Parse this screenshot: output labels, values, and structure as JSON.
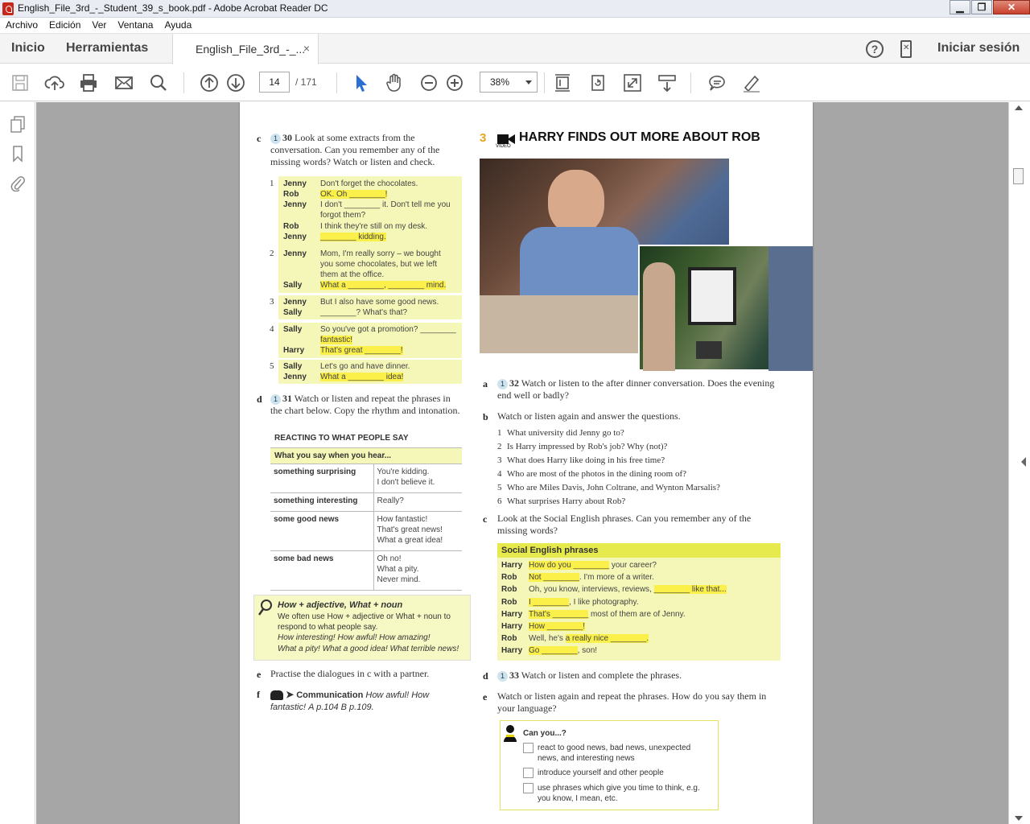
{
  "window": {
    "title": "English_File_3rd_-_Student_39_s_book.pdf - Adobe Acrobat Reader DC",
    "minimize": "▁",
    "maximize": "❐",
    "close": "✕"
  },
  "menu": [
    "Archivo",
    "Edición",
    "Ver",
    "Ventana",
    "Ayuda"
  ],
  "nav": {
    "home": "Inicio",
    "tools": "Herramientas",
    "doc_tab": "English_File_3rd_-_...",
    "doc_tab_close": "×",
    "help": "?",
    "signin": "Iniciar sesión"
  },
  "toolbar": {
    "page_current": "14",
    "page_total": "/ 171",
    "zoom": "38%"
  },
  "pdf": {
    "left": {
      "c_letter": "c",
      "c_badge": "1",
      "c_track": "30",
      "c_text": "Look at some extracts from the conversation. Can you remember any of the missing words? Watch or listen and check.",
      "dialogues": [
        {
          "n": "1",
          "lines": [
            {
              "s": "Jenny",
              "t": "Don't forget the chocolates."
            },
            {
              "s": "Rob",
              "t": "OK. Oh ________!"
            },
            {
              "s": "Jenny",
              "t": "I don't ________ it. Don't tell me you"
            },
            {
              "s": "",
              "t": "forgot them?"
            },
            {
              "s": "Rob",
              "t": "I think they're still on my desk."
            },
            {
              "s": "Jenny",
              "t": "________ kidding."
            }
          ]
        },
        {
          "n": "2",
          "lines": [
            {
              "s": "Jenny",
              "t": "Mom, I'm really sorry – we bought"
            },
            {
              "s": "",
              "t": "you some chocolates, but we left"
            },
            {
              "s": "",
              "t": "them at the office."
            },
            {
              "s": "Sally",
              "t": "What a ________, ________ mind."
            }
          ]
        },
        {
          "n": "3",
          "lines": [
            {
              "s": "Jenny",
              "t": "But I also have some good news."
            },
            {
              "s": "Sally",
              "t": "________? What's that?"
            }
          ]
        },
        {
          "n": "4",
          "lines": [
            {
              "s": "Sally",
              "t": "So you've got a promotion? ________"
            },
            {
              "s": "",
              "t": "fantastic!"
            },
            {
              "s": "Harry",
              "t": "That's great ________!"
            }
          ]
        },
        {
          "n": "5",
          "lines": [
            {
              "s": "Sally",
              "t": "Let's go and have dinner."
            },
            {
              "s": "Jenny",
              "t": "What a ________ idea!"
            }
          ]
        }
      ],
      "d_letter": "d",
      "d_badge": "1",
      "d_track": "31",
      "d_text": "Watch or listen and repeat the phrases in the chart below. Copy the rhythm and intonation.",
      "table_title": "REACTING TO WHAT PEOPLE SAY",
      "table_header": "What you say when you hear...",
      "table_rows": [
        {
          "k": "something surprising",
          "v": "You're kidding.\nI don't believe it."
        },
        {
          "k": "something interesting",
          "v": "Really?"
        },
        {
          "k": "some good news",
          "v": "How fantastic!\nThat's great news!\nWhat a great idea!"
        },
        {
          "k": "some bad news",
          "v": "Oh no!\nWhat a pity.\nNever mind."
        }
      ],
      "tip_title": "How + adjective, What + noun",
      "tip_text1": "We often use How + adjective or What + noun to respond to what people say.",
      "tip_text2": "How interesting! How awful! How amazing!",
      "tip_text3": "What a pity! What a good idea! What terrible news!",
      "e_letter": "e",
      "e_text": "Practise the dialogues in c with a partner.",
      "f_letter": "f",
      "f_text1": "Communication",
      "f_text2": "How awful! How fantastic!",
      "f_text3": "A p.104 B p.109."
    },
    "right": {
      "section_num": "3",
      "video_label": "VIDEO",
      "heading": "HARRY FINDS OUT MORE ABOUT ROB",
      "a_letter": "a",
      "a_badge": "1",
      "a_track": "32",
      "a_text": "Watch or listen to the after dinner conversation. Does the evening end well or badly?",
      "b_letter": "b",
      "b_text": "Watch or listen again and answer the questions.",
      "questions": [
        {
          "n": "1",
          "t": "What university did Jenny go to?"
        },
        {
          "n": "2",
          "t": "Is Harry impressed by Rob's job? Why (not)?"
        },
        {
          "n": "3",
          "t": "What does Harry like doing in his free time?"
        },
        {
          "n": "4",
          "t": "Who are most of the photos in the dining room of?"
        },
        {
          "n": "5",
          "t": "Who are Miles Davis, John Coltrane, and Wynton Marsalis?"
        },
        {
          "n": "6",
          "t": "What surprises Harry about Rob?"
        }
      ],
      "c_letter": "c",
      "c_text": "Look at the Social English phrases. Can you remember any of the missing words?",
      "phrases_title": "Social English phrases",
      "phrases": [
        {
          "s": "Harry",
          "a": "How do you ________",
          "b": " your career?"
        },
        {
          "s": "Rob",
          "a": "Not ________",
          "b": ". I'm more of a writer."
        },
        {
          "s": "Rob",
          "a": "",
          "b": "Oh, you know, interviews, reviews, ",
          "c": "________ like that..."
        },
        {
          "s": "Rob",
          "a": "I ________",
          "b": ", I like photography."
        },
        {
          "s": "Harry",
          "a": "That's ________",
          "b": " most of them are of Jenny."
        },
        {
          "s": "Harry",
          "a": "How ________!",
          "b": ""
        },
        {
          "s": "Rob",
          "a": "",
          "b": "Well, he's ",
          "c": "a really nice ________."
        },
        {
          "s": "Harry",
          "a": "Go ________",
          "b": ", son!"
        }
      ],
      "d_letter": "d",
      "d_badge": "1",
      "d_track": "33",
      "d_text": "Watch or listen and complete the phrases.",
      "e_letter": "e",
      "e_text": "Watch or listen again and repeat the phrases. How do you say them in your language?",
      "canyou_title": "Can you...?",
      "canyou": [
        "react to good news, bad news, unexpected news, and interesting news",
        "introduce yourself and other people",
        "use phrases which give you time to think, e.g. you know, I mean, etc."
      ]
    }
  }
}
